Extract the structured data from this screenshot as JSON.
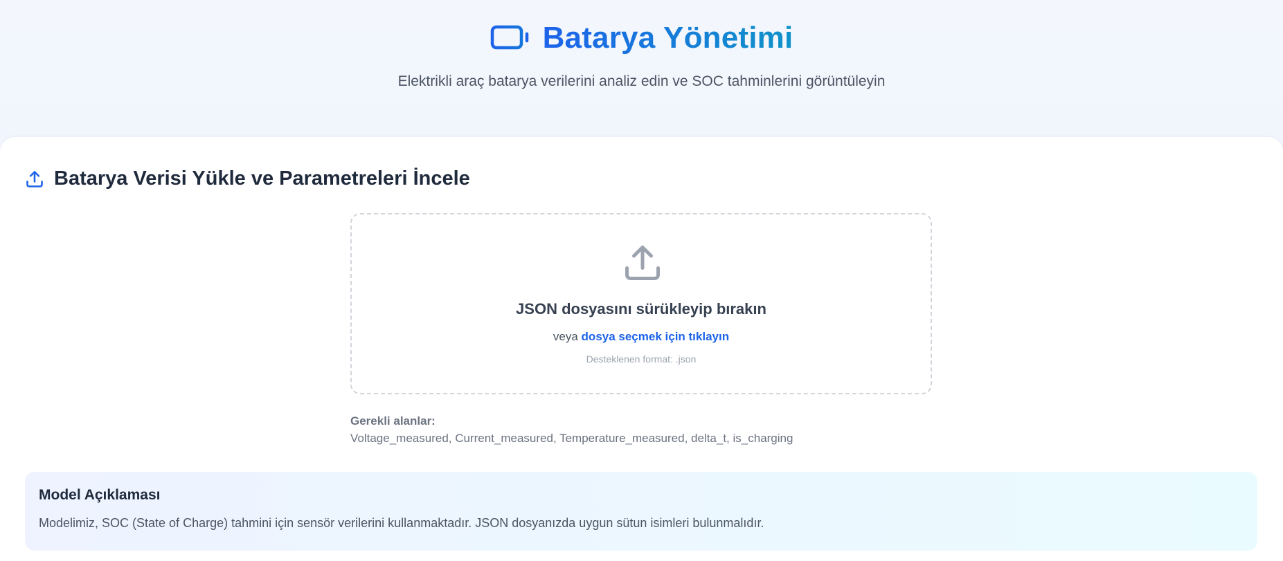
{
  "hero": {
    "title": "Batarya Yönetimi",
    "subtitle": "Elektrikli araç batarya verilerini analiz edin ve SOC tahminlerini görüntüleyin",
    "icon": "battery-icon"
  },
  "upload_section": {
    "title": "Batarya Verisi Yükle ve Parametreleri İncele",
    "icon": "upload-icon",
    "dropzone": {
      "icon": "upload-icon",
      "title": "JSON dosyasını sürükleyip bırakın",
      "alt_prefix": "veya",
      "alt_link": "dosya seçmek için tıklayın",
      "format_note": "Desteklenen format: .json"
    },
    "required_label": "Gerekli alanlar:",
    "required_fields": "Voltage_measured, Current_measured, Temperature_measured, delta_t, is_charging"
  },
  "model_info": {
    "title": "Model Açıklaması",
    "text": "Modelimiz, SOC (State of Charge) tahmini için sensör verilerini kullanmaktadır. JSON dosyanızda uygun sütun isimleri bulunmalıdır."
  },
  "colors": {
    "accent": "#1d63ea",
    "accent_secondary": "#0f93c9",
    "heading": "#1f2a3c",
    "muted": "#6b7280"
  }
}
